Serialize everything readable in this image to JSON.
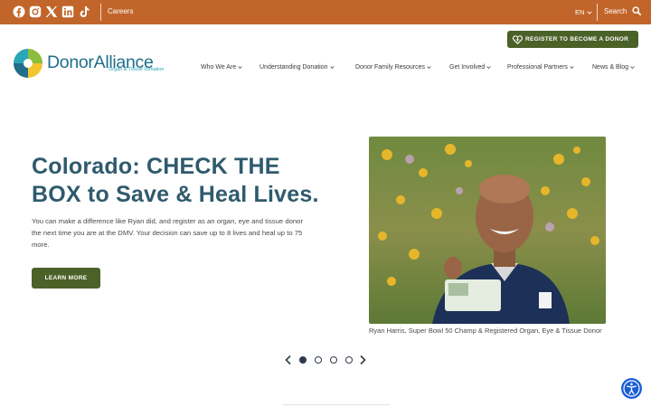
{
  "topbar": {
    "social_icons": [
      "facebook-icon",
      "instagram-icon",
      "x-icon",
      "linkedin-icon",
      "tiktok-icon"
    ],
    "careers_label": "Careers",
    "language_label": "EN",
    "search_label": "Search"
  },
  "header": {
    "register_label": "REGISTER TO BECOME A DONOR",
    "logo": {
      "name": "DonorAlliance",
      "tagline": "Organ & Tissue Donation"
    },
    "nav": [
      {
        "label": "Who We Are"
      },
      {
        "label": "Understanding Donation"
      },
      {
        "label": "Donor Family Resources"
      },
      {
        "label": "Get Involved"
      },
      {
        "label": "Professional Partners"
      },
      {
        "label": "News & Blog"
      }
    ]
  },
  "hero": {
    "headline": "Colorado: CHECK THE BOX to Save & Heal Lives.",
    "description": "You can make a difference like Ryan did, and register as an organ, eye and tissue donor the next time you are at the DMV. Your decision can save up to 8 lives and heal up to 75 more.",
    "cta_label": "LEARN MORE",
    "image_caption": "Ryan Harris, Super Bowl 50 Champ & Registered Organ, Eye & Tissue Donor"
  },
  "carousel": {
    "slide_count": 4,
    "active_slide": 1
  },
  "colors": {
    "topbar": "#c1652a",
    "button_green": "#4a6128",
    "headline_blue": "#2f5a6d",
    "accessibility_blue": "#1a5fd4"
  }
}
